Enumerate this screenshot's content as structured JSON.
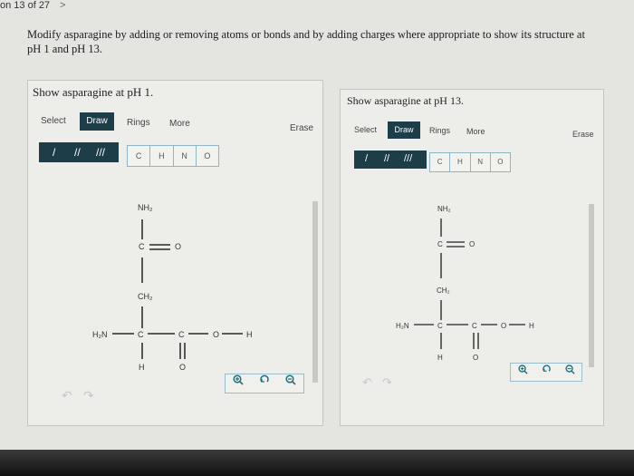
{
  "nav": {
    "question": "on 13 of 27",
    "next": ">"
  },
  "prompt": {
    "line1": "Modify asparagine by adding or removing atoms or bonds and by adding charges where appropriate to show its structure at",
    "line2": "pH 1 and pH 13."
  },
  "left_panel": {
    "title": "Show asparagine at pH 1."
  },
  "right_panel": {
    "title": "Show asparagine at pH 13."
  },
  "toolbar": {
    "select": "Select",
    "draw": "Draw",
    "rings": "Rings",
    "more": "More",
    "erase": "Erase"
  },
  "bonds": {
    "single": "/",
    "double": "//",
    "triple": "///"
  },
  "atoms": [
    "C",
    "H",
    "N",
    "O"
  ],
  "molecule": {
    "nh2": "NH₂",
    "c_top": "C",
    "o_top": "O",
    "ch2": "CH₂",
    "h2n": "H₂N",
    "c_alpha": "C",
    "c_carboxyl": "C",
    "o_single": "O",
    "h_acid": "H",
    "h_bottom": "H",
    "o_bottom": "O"
  },
  "zoom": {
    "zoom_in_icon": "zoom-in-icon",
    "reset_icon": "reset-icon",
    "zoom_out_icon": "zoom-out-icon"
  },
  "undo": {
    "undo": "↶",
    "redo": "↷"
  },
  "colors": {
    "accent": "#1d3d49",
    "atom_border": "#8fb4c4",
    "zoom_icon": "#1d6f80"
  }
}
